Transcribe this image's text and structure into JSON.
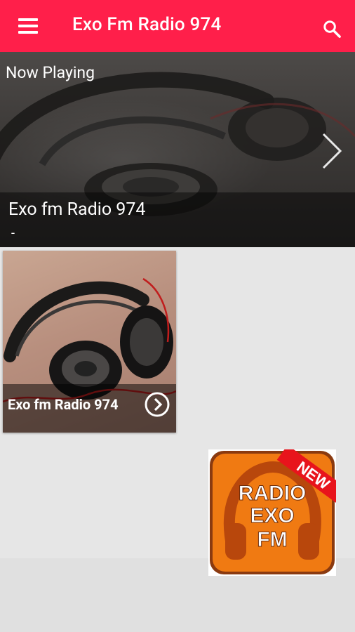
{
  "appbar": {
    "title": "Exo Fm Radio 974",
    "menu_icon": "menu-icon",
    "search_icon": "search-icon",
    "color": "#ff1f4a"
  },
  "now_playing": {
    "label": "Now Playing",
    "station": "Exo fm Radio 974",
    "subtitle": "-",
    "next_icon": "chevron-right-icon"
  },
  "stations": [
    {
      "name": "Exo fm Radio 974",
      "icon": "play-circle-icon"
    }
  ],
  "ad": {
    "badge": "NEW",
    "line1": "RADIO",
    "line2": "EXO",
    "line3": "FM",
    "bg_color": "#f07a12",
    "badge_color": "#e8141c"
  }
}
